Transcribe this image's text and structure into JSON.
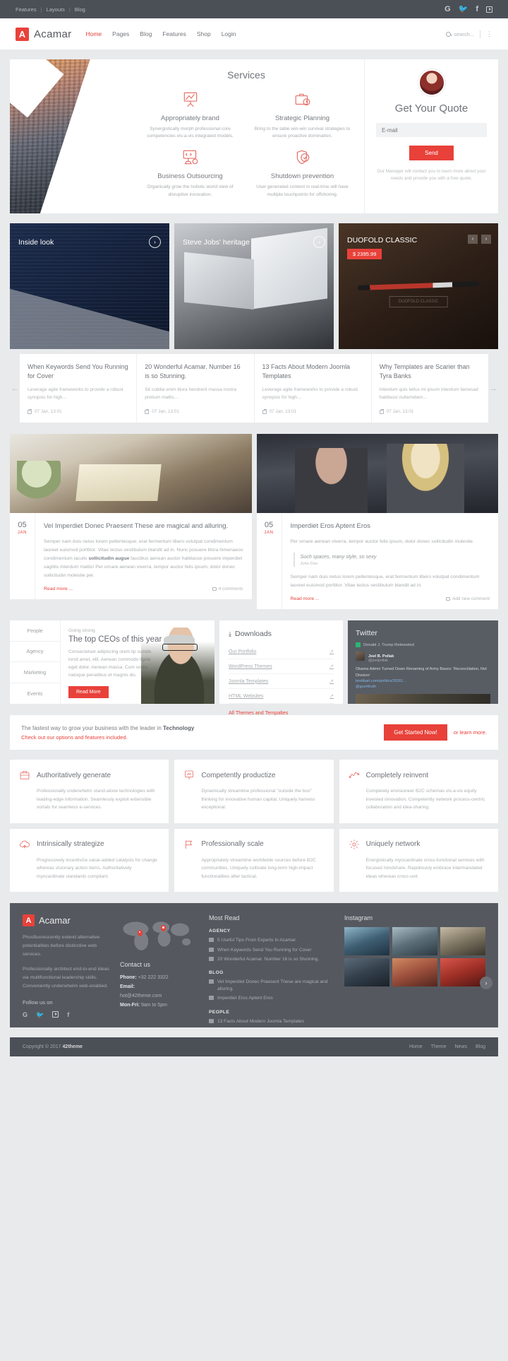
{
  "topbar": {
    "links": [
      "Features",
      "Layouts",
      "Blog"
    ],
    "social": [
      "google-plus-icon",
      "twitter-icon",
      "facebook-icon",
      "youtube-icon"
    ]
  },
  "header": {
    "brand": "Acamar",
    "brand_mark": "A",
    "nav": [
      {
        "label": "Home",
        "active": true
      },
      {
        "label": "Pages",
        "active": false
      },
      {
        "label": "Blog",
        "active": false
      },
      {
        "label": "Features",
        "active": false
      },
      {
        "label": "Shop",
        "active": false
      },
      {
        "label": "Login",
        "active": false
      }
    ],
    "search_placeholder": "search...",
    "more": "⋮"
  },
  "hero": {
    "title": "Services",
    "services": [
      {
        "icon": "easel-chart-icon",
        "title": "Appropriately brand",
        "text": "Synergistically morph professional core competencies vis-a-vis integrated models."
      },
      {
        "icon": "briefcase-clock-icon",
        "title": "Strategic Planning",
        "text": "Bring to the table win-win survival strategies to ensure proactive domination."
      },
      {
        "icon": "code-monitor-gear-icon",
        "title": "Business Outsourcing",
        "text": "Organically grow the holistic world view of disruptive innovation."
      },
      {
        "icon": "shield-check-icon",
        "title": "Shutdown prevention",
        "text": "User generated content in real-time will have multiple touchpoints for offshoring."
      }
    ],
    "quote": {
      "heading": "Get Your Quote",
      "email_placeholder": "E-mail",
      "email_value": "",
      "send_label": "Send",
      "note": "Our Manager will contact you to learn more about your needs and provide you with a free quote."
    }
  },
  "carousel": {
    "slides": [
      {
        "title": "Inside look",
        "arrow": "›"
      },
      {
        "title": "Steve Jobs' heritage",
        "arrow": "›"
      },
      {
        "title": "DUOFOLD CLASSIC",
        "price": "$ 2395.99",
        "prev": "‹",
        "next": "›",
        "watermark": "DUOFOLD CLASSIC"
      }
    ]
  },
  "news": {
    "prev": "←",
    "next": "→",
    "cards": [
      {
        "title": "When Keywords Send You Running for Cover",
        "excerpt": "Leverage agile frameworks to provide a robust synopsis for high...",
        "date": "07 Jan, 13:01"
      },
      {
        "title": "20 Wonderful Acamar. Number 16 is so Stunning.",
        "excerpt": "Sit cubilia enim litora hendrerit massa nostra pretium mattis...",
        "date": "07 Jan, 13:01"
      },
      {
        "title": "13 Facts About Modern Joomla Templates",
        "excerpt": "Leverage agile frameworks to provide a robust synopsis for high...",
        "date": "07 Jan, 13:01"
      },
      {
        "title": "Why Templates are Scarier than Tyra Banks",
        "excerpt": "Interdum quis tellus mi ipsum interdum famesad habitassi nullamdiam...",
        "date": "07 Jan, 13:01"
      }
    ]
  },
  "blogs": [
    {
      "day": "05",
      "month": "JAN",
      "title": "Vel Imperdiet Donec Praesent These are magical and alluring.",
      "body_1": "Semper nam duis netus lorem pellentesque, erat fermentum libero volutpat condimentum laoreet euismod porttitor. Vitae lectus vestibulum blandit ad in. Nunc posuere litora himenaeos condimentum iaculis ",
      "body_bold": "sollicitudin augue",
      "body_2": " faucibus aenean auctor habitasse posuere imperdiet sagittis interdum mattis! Per ornare aenean viverra, tempor auctor felis ipsum, dolor donec sollicitudin molestie per.",
      "read_more": "Read more ...",
      "comments": "4 comments"
    },
    {
      "day": "05",
      "month": "JAN",
      "title": "Imperdiet Eros Aptent Eros",
      "body_1": "Per ornare aenean viverra, tempor auctor felis ipsum, dolor donec sollicitudin molestie.",
      "quote_text": "Such spaces, many style, so sexy",
      "quote_author": "John Doe",
      "body_2": "Semper nam duis netus lorem pellentesque, erat fermentum libero volutpat condimentum laoreet euismod porttitor. Vitae lectus vestibulum blandit ad in.",
      "read_more": "Read more ...",
      "comments": "Add new comment"
    }
  ],
  "tabs": {
    "items": [
      {
        "label": "People",
        "active": true
      },
      {
        "label": "Agency",
        "active": false
      },
      {
        "label": "Marketing",
        "active": false
      },
      {
        "label": "Events",
        "active": false
      }
    ],
    "kicker": "Going strong",
    "heading": "The top CEOs of this year",
    "text": "Consectetuer adipiscing orem lip sumdo lorsit amet, elit. Aenean commodo ligula eget dolor. Aenean massa. Cum sociis natoque penatibus et magnis dis.",
    "button": "Read More"
  },
  "downloads": {
    "heading": "Downloads",
    "icon": "download-icon",
    "items": [
      "Our Portfolio",
      "WordPress Themes",
      "Joomla Templates",
      "HTML Websites"
    ],
    "all_link": "All Themes and Tempaltes"
  },
  "twitter": {
    "heading": "Twitter",
    "account": "Donald J. Trump Retweeted",
    "tweet_name": "Joel B. Pollak",
    "tweet_handle": "@joelpollak",
    "tweet_text": "Obama Admin Turned Down Renaming of Army Bases: 'Reconciliation, Not Division'",
    "tweet_link_1": "breitbart.com/politics/2020/...",
    "tweet_link_2": "@gov#truth"
  },
  "cta": {
    "line1_a": "The fastest way to grow your business with the leader in ",
    "line1_b": "Technology",
    "line2": "Check out our options and features included.",
    "button": "Get Started Now!",
    "link": "or learn more."
  },
  "features": [
    {
      "icon": "briefcase-icon",
      "title": "Authoritatively generate",
      "text": "Professionally underwhelm stand-alone technologies with leading-edge information. Seamlessly exploit extensible vortals for seamless e-services."
    },
    {
      "icon": "presentation-icon",
      "title": "Competently productize",
      "text": "Dynamically streamline professional \"outside the box\" thinking for innovative human capital. Uniquely harness exceptional."
    },
    {
      "icon": "chart-line-icon",
      "title": "Completely reinvent",
      "text": "Completely envisioneer B2C schemas vis-a-vis equity invested innovation. Competently network process-centric collaboration and idea-sharing."
    },
    {
      "icon": "cloud-upload-icon",
      "title": "Intrinsically strategize",
      "text": "Progressively incentivize value-added catalysts for change whereas visionary action items. Authoritatively myocardinate standards compliant."
    },
    {
      "icon": "flag-icon",
      "title": "Professionally scale",
      "text": "Appropriately streamline worldwide sources before B2C communities. Uniquely cultivate long-term high-impact functionalities after tactical."
    },
    {
      "icon": "gear-icon",
      "title": "Uniquely network",
      "text": "Energistically myocardinate cross-functional services with focused mindshare. Rapidiously embrace intermandated ideas whereas cross-unit."
    }
  ],
  "footer": {
    "brand": "Acamar",
    "brand_mark": "A",
    "about_1": "Phosfluorescently extend alternative potentialities before distinctive web services.",
    "about_2": "Professionally architect end-to-end ideas via multifunctional leadership skills. Conveniently underwhelm web-enabled.",
    "follow_label": "Follow us on",
    "social": [
      "google-plus-icon",
      "twitter-icon",
      "youtube-icon",
      "facebook-icon"
    ],
    "contact_heading": "Contact us",
    "phone_label": "Phone:",
    "phone": "+32 222 3322",
    "email_label": "Email:",
    "email": "hot@42theme.com",
    "hours_label": "Mon-Fri:",
    "hours": "9am to 5pm",
    "most_read_heading": "Most Read",
    "groups": [
      {
        "category": "AGENCY",
        "links": [
          "5 Useful Tips From Experts In Acamar.",
          "When Keywords Send You Running for Cover",
          "20 Wonderful Acamar. Number 16 is so Stunning."
        ]
      },
      {
        "category": "BLOG",
        "links": [
          "Vel Imperdiet Donec Praesent These are magical and alluring.",
          "Imperdiet Eros Aptent Eros"
        ]
      },
      {
        "category": "PEOPLE",
        "links": [
          "13 Facts About Modern Joomla Templates"
        ]
      }
    ],
    "instagram_heading": "Instagram",
    "instagram_next": "›",
    "copyright_a": "Copyright © 2017 ",
    "copyright_b": "42theme",
    "bottom_links": [
      "Home",
      "Theme",
      "News",
      "Blog"
    ]
  },
  "colors": {
    "accent": "#e8413a",
    "dark": "#55595f",
    "topbar": "#4b4f56",
    "page_bg": "#e8eaec"
  }
}
